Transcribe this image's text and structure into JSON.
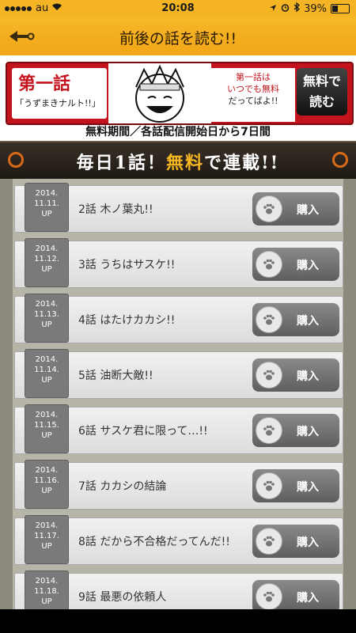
{
  "status": {
    "carrier": "au",
    "time": "20:08",
    "battery": "39%"
  },
  "header": {
    "title": "前後の話を読む!!"
  },
  "banner": {
    "episode_label": "第一話",
    "subtitle": "「うずまきナルト!!」",
    "copy_line1": "第一話は",
    "copy_line2": "いつでも無料",
    "copy_line3": "だってばよ!!",
    "cta_line1": "無料で",
    "cta_line2": "読む",
    "note": "無料期間／各話配信開始日から7日間"
  },
  "daily": {
    "part1": "毎日1話！",
    "highlight": "無料",
    "part2": "で連載!!"
  },
  "episodes": [
    {
      "date": [
        "2014.",
        "11.11.",
        "UP"
      ],
      "title": "2話 木ノ葉丸!!",
      "buy": "購入"
    },
    {
      "date": [
        "2014.",
        "11.12.",
        "UP"
      ],
      "title": "3話 うちはサスケ!!",
      "buy": "購入"
    },
    {
      "date": [
        "2014.",
        "11.13.",
        "UP"
      ],
      "title": "4話 はたけカカシ!!",
      "buy": "購入"
    },
    {
      "date": [
        "2014.",
        "11.14.",
        "UP"
      ],
      "title": "5話 油断大敵!!",
      "buy": "購入"
    },
    {
      "date": [
        "2014.",
        "11.15.",
        "UP"
      ],
      "title": "6話 サスケ君に限って…!!",
      "buy": "購入"
    },
    {
      "date": [
        "2014.",
        "11.16.",
        "UP"
      ],
      "title": "7話 カカシの結論",
      "buy": "購入"
    },
    {
      "date": [
        "2014.",
        "11.17.",
        "UP"
      ],
      "title": "8話 だから不合格だってんだ!!",
      "buy": "購入"
    },
    {
      "date": [
        "2014.",
        "11.18.",
        "UP"
      ],
      "title": "9話 最悪の依頼人",
      "buy": "購入"
    }
  ]
}
